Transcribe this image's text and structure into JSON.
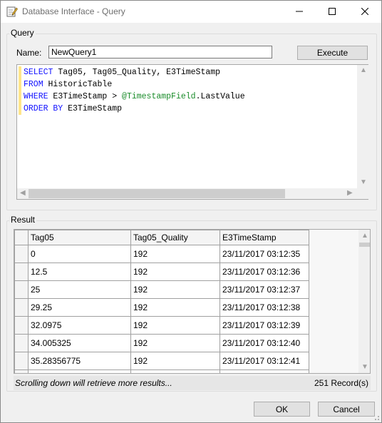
{
  "window": {
    "title": "Database Interface - Query",
    "icon": "query-pencil-icon"
  },
  "query_group": {
    "label": "Query",
    "name_label": "Name:",
    "name_value": "NewQuery1",
    "execute_label": "Execute",
    "sql_lines": [
      [
        {
          "t": "SELECT",
          "k": "kw"
        },
        {
          "t": " Tag05, Tag05_Quality, E3TimeStamp",
          "k": "plain"
        }
      ],
      [
        {
          "t": "FROM",
          "k": "kw"
        },
        {
          "t": " HistoricTable",
          "k": "plain"
        }
      ],
      [
        {
          "t": "WHERE",
          "k": "kw"
        },
        {
          "t": " E3TimeStamp > ",
          "k": "plain"
        },
        {
          "t": "@TimestampField",
          "k": "var"
        },
        {
          "t": ".LastValue",
          "k": "plain"
        }
      ],
      [
        {
          "t": "ORDER BY",
          "k": "kw"
        },
        {
          "t": " E3TimeStamp",
          "k": "plain"
        }
      ]
    ]
  },
  "result_group": {
    "label": "Result",
    "columns": [
      "Tag05",
      "Tag05_Quality",
      "E3TimeStamp"
    ],
    "rows": [
      [
        "0",
        "192",
        "23/11/2017 03:12:35"
      ],
      [
        "12.5",
        "192",
        "23/11/2017 03:12:36"
      ],
      [
        "25",
        "192",
        "23/11/2017 03:12:37"
      ],
      [
        "29.25",
        "192",
        "23/11/2017 03:12:38"
      ],
      [
        "32.0975",
        "192",
        "23/11/2017 03:12:39"
      ],
      [
        "34.005325",
        "192",
        "23/11/2017 03:12:40"
      ],
      [
        "35.28356775",
        "192",
        "23/11/2017 03:12:41"
      ],
      [
        "",
        "",
        ""
      ]
    ],
    "status_message": "Scrolling down will retrieve more results...",
    "record_count": "251 Record(s)"
  },
  "footer": {
    "ok_label": "OK",
    "cancel_label": "Cancel"
  },
  "colors": {
    "keyword": "#1010ff",
    "variable": "#1a8c2a",
    "gutter_marker": "#ffe58a"
  }
}
